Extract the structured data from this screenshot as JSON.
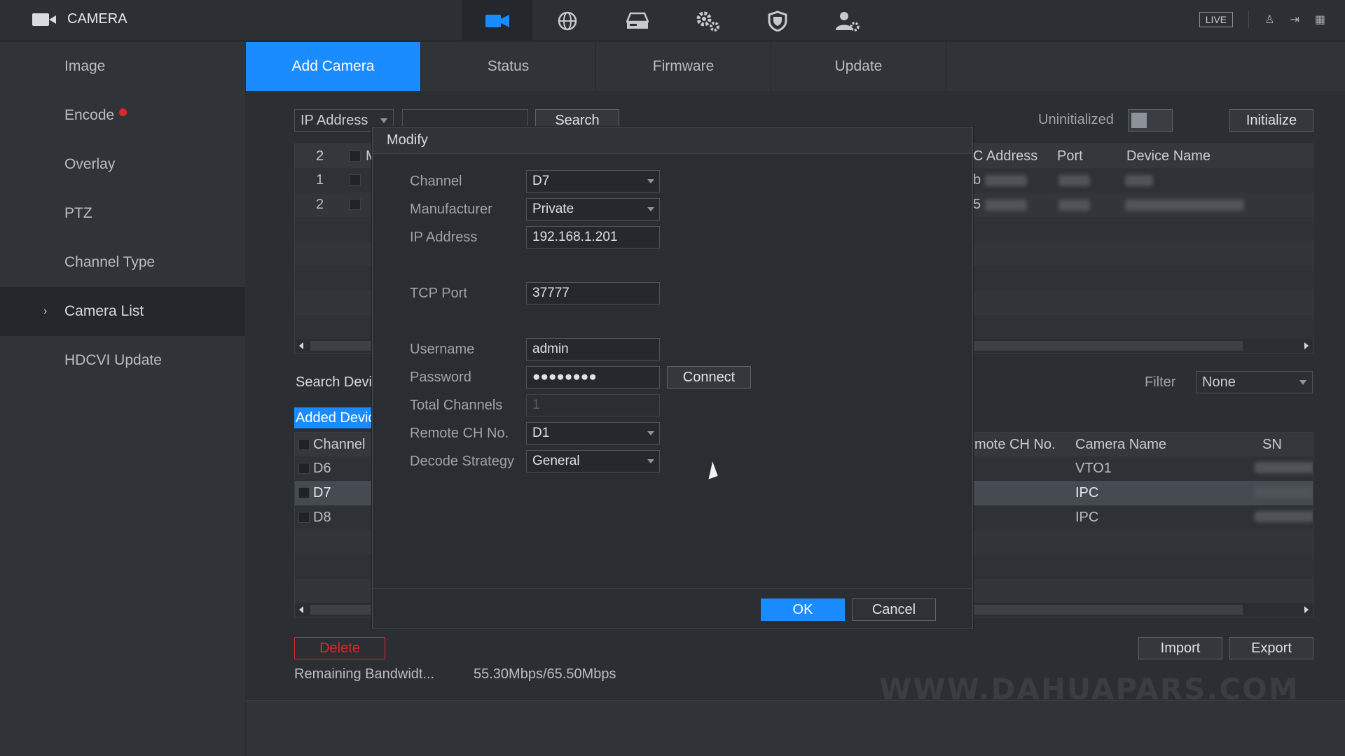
{
  "app": {
    "title": "CAMERA",
    "live_badge": "LIVE"
  },
  "topnav": [
    {
      "icon": "video-camera-icon",
      "glyph": "■"
    },
    {
      "icon": "network-globe-icon",
      "glyph": "◍"
    },
    {
      "icon": "storage-icon",
      "glyph": "⌸"
    },
    {
      "icon": "settings-gears-icon",
      "glyph": "✲"
    },
    {
      "icon": "security-shield-icon",
      "glyph": "⛉"
    },
    {
      "icon": "account-settings-icon",
      "glyph": "♟"
    }
  ],
  "topright": {
    "user_glyph": "♙",
    "logout_glyph": "⇥",
    "qr_glyph": "▦"
  },
  "sidebar": {
    "items": [
      {
        "label": "Image"
      },
      {
        "label": "Encode"
      },
      {
        "label": "Overlay"
      },
      {
        "label": "PTZ"
      },
      {
        "label": "Channel Type"
      },
      {
        "label": "Camera List"
      },
      {
        "label": "HDCVI Update"
      }
    ],
    "active_index": 5,
    "chevron": "›"
  },
  "tabs": [
    "Add Camera",
    "Status",
    "Firmware",
    "Update"
  ],
  "search_bar": {
    "type_value": "IP Address",
    "search_label": "Search",
    "uninitialized_label": "Uninitialized",
    "initialize_label": "Initialize"
  },
  "device_table": {
    "header_count": "2",
    "header_partial": "M",
    "col_mac": "C Address",
    "col_port": "Port",
    "col_device_name": "Device Name",
    "rows": [
      {
        "num": "1",
        "mac_partial": "b"
      },
      {
        "num": "2",
        "mac_partial": "5"
      }
    ]
  },
  "search_device_label": "Search Devi",
  "filter": {
    "label": "Filter",
    "value": "None"
  },
  "added_devices": {
    "label": "Added Devic",
    "col_channel": "Channel",
    "col_remote_ch": "mote CH No.",
    "col_camera_name": "Camera Name",
    "col_sn": "SN",
    "rows": [
      {
        "channel": "D6",
        "camera_name": "VTO1"
      },
      {
        "channel": "D7",
        "camera_name": "IPC"
      },
      {
        "channel": "D8",
        "camera_name": "IPC"
      }
    ]
  },
  "bottom": {
    "delete_label": "Delete",
    "import_label": "Import",
    "export_label": "Export",
    "bandwidth_label": "Remaining Bandwidt...",
    "bandwidth_value": "55.30Mbps/65.50Mbps"
  },
  "watermark": "WWW.DAHUAPARS.COM",
  "modal": {
    "title": "Modify",
    "fields": {
      "channel": {
        "label": "Channel",
        "value": "D7"
      },
      "manufacturer": {
        "label": "Manufacturer",
        "value": "Private"
      },
      "ip_address": {
        "label": "IP Address",
        "value": "192.168.1.201"
      },
      "tcp_port": {
        "label": "TCP Port",
        "value": "37777"
      },
      "username": {
        "label": "Username",
        "value": "admin"
      },
      "password": {
        "label": "Password",
        "value": "●●●●●●●●"
      },
      "total_channels": {
        "label": "Total Channels",
        "value": "1"
      },
      "remote_ch_no": {
        "label": "Remote CH No.",
        "value": "D1"
      },
      "decode_strategy": {
        "label": "Decode Strategy",
        "value": "General"
      }
    },
    "connect_label": "Connect",
    "ok_label": "OK",
    "cancel_label": "Cancel"
  },
  "colors": {
    "accent": "#1a8cff",
    "danger": "#e1252b",
    "background": "#2b2e32"
  }
}
